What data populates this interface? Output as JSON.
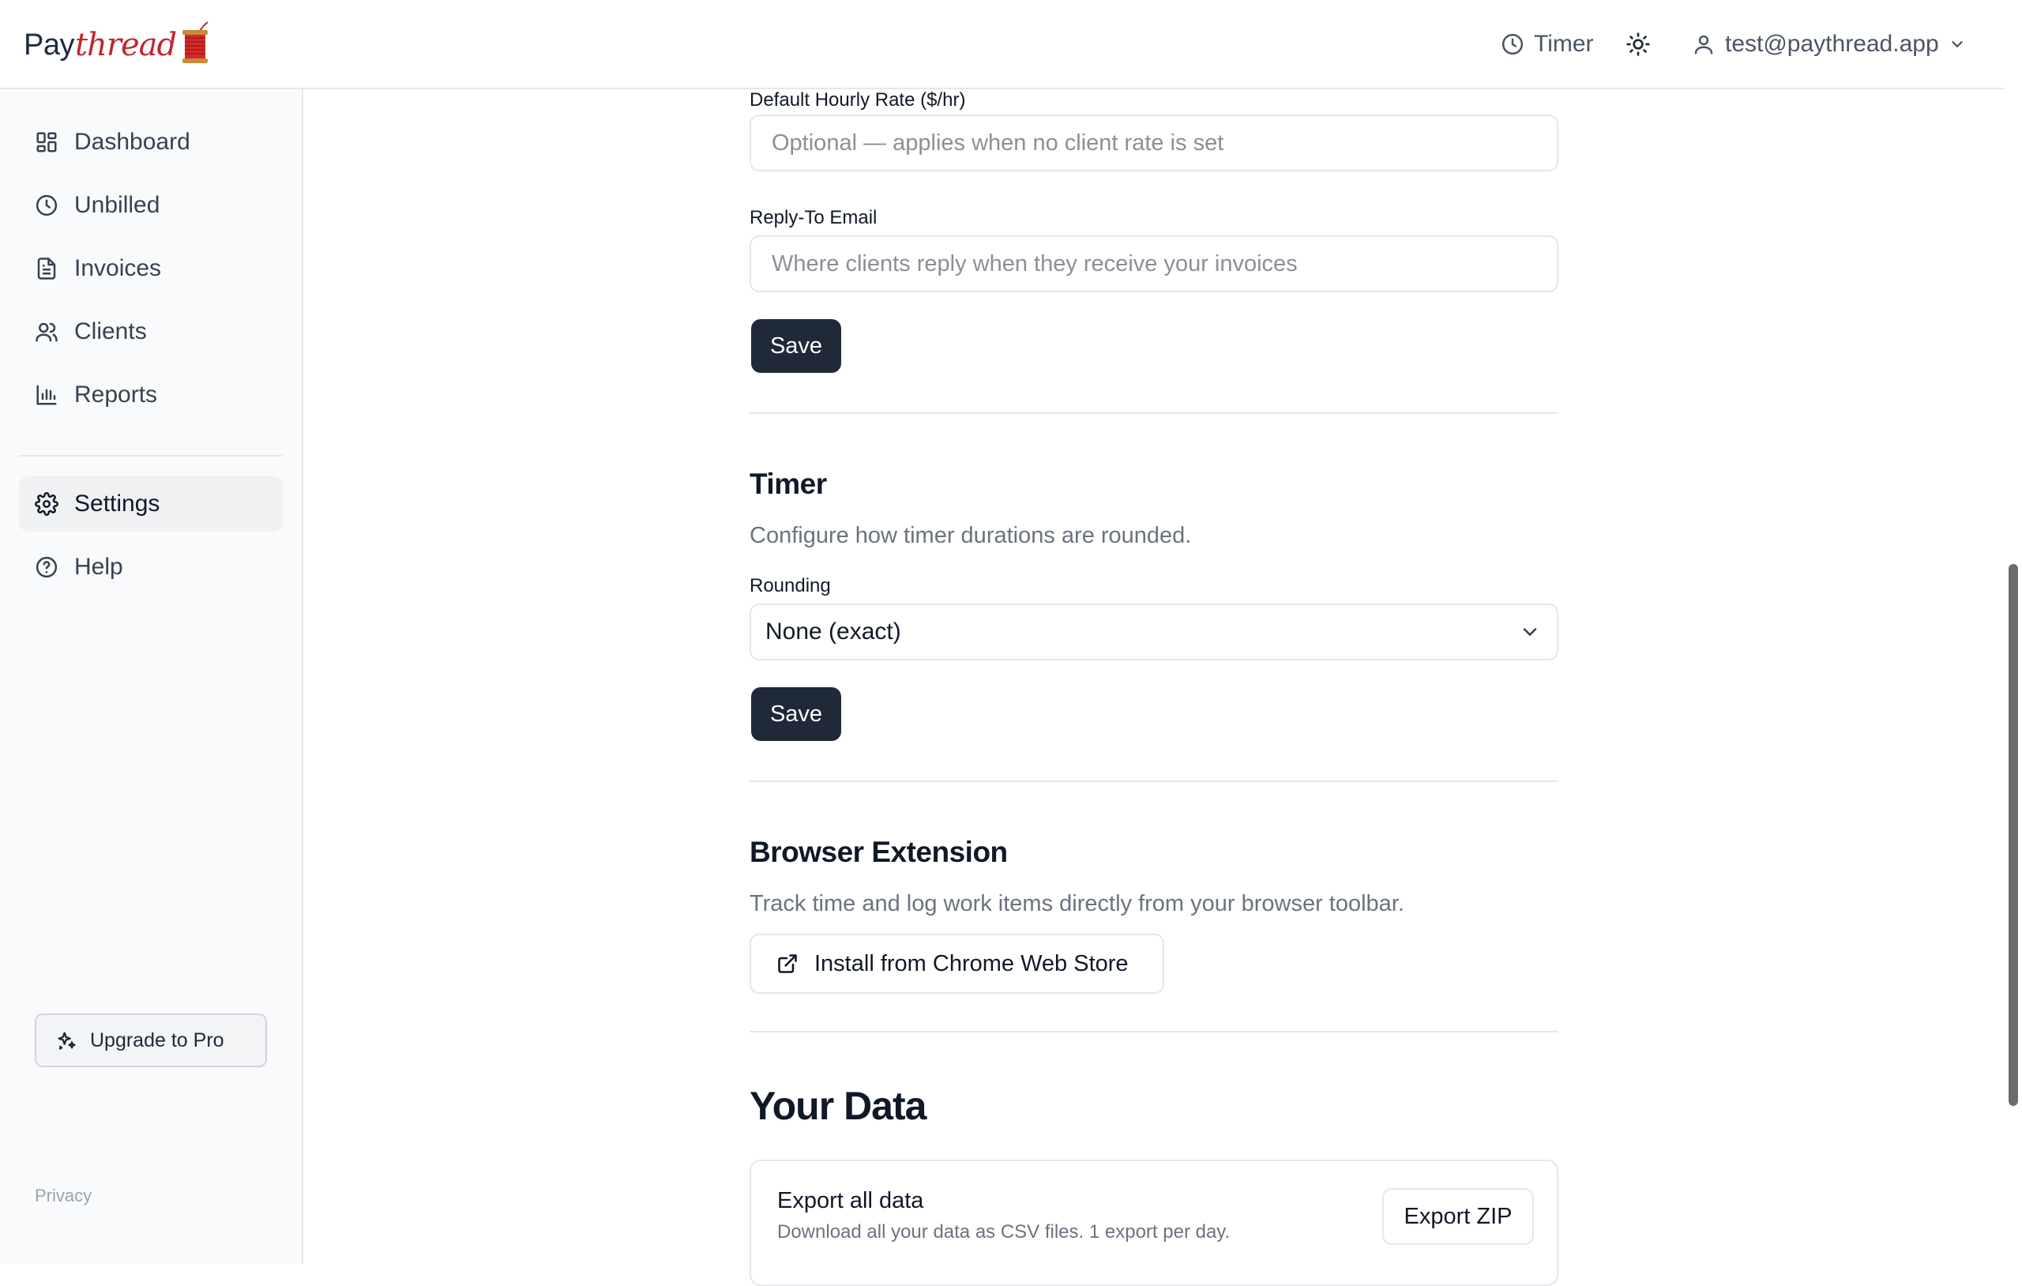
{
  "brand": {
    "part1": "Pay",
    "part2": "thread",
    "accent": "#c0272d"
  },
  "header": {
    "timer_label": "Timer",
    "timer_icon": "clock-icon",
    "theme_icon": "sun-icon",
    "user_email": "test@paythread.app",
    "user_icon": "user-icon",
    "menu_icon": "chevron-down-icon"
  },
  "sidebar": {
    "items": [
      {
        "label": "Dashboard",
        "icon": "dashboard-icon"
      },
      {
        "label": "Unbilled",
        "icon": "clock-icon"
      },
      {
        "label": "Invoices",
        "icon": "file-text-icon"
      },
      {
        "label": "Clients",
        "icon": "users-icon"
      },
      {
        "label": "Reports",
        "icon": "bar-chart-icon"
      }
    ],
    "settings_label": "Settings",
    "help_label": "Help",
    "upgrade_label": "Upgrade to Pro",
    "privacy_label": "Privacy",
    "active": "Settings"
  },
  "settings": {
    "hourly_rate": {
      "label": "Default Hourly Rate ($/hr)",
      "placeholder": "Optional — applies when no client rate is set",
      "value": ""
    },
    "reply_to": {
      "label": "Reply-To Email",
      "placeholder": "Where clients reply when they receive your invoices",
      "value": ""
    },
    "save_label": "Save",
    "timer": {
      "title": "Timer",
      "description": "Configure how timer durations are rounded.",
      "rounding_label": "Rounding",
      "rounding_value": "None (exact)",
      "save_label": "Save"
    },
    "extension": {
      "title": "Browser Extension",
      "description": "Track time and log work items directly from your browser toolbar.",
      "install_label": "Install from Chrome Web Store"
    },
    "your_data": {
      "title": "Your Data",
      "export_title": "Export all data",
      "export_desc": "Download all your data as CSV files. 1 export per day.",
      "export_button": "Export ZIP"
    }
  },
  "colors": {
    "primary_button": "#1f2937",
    "border": "#e5e7eb",
    "muted_text": "#6b7280"
  }
}
